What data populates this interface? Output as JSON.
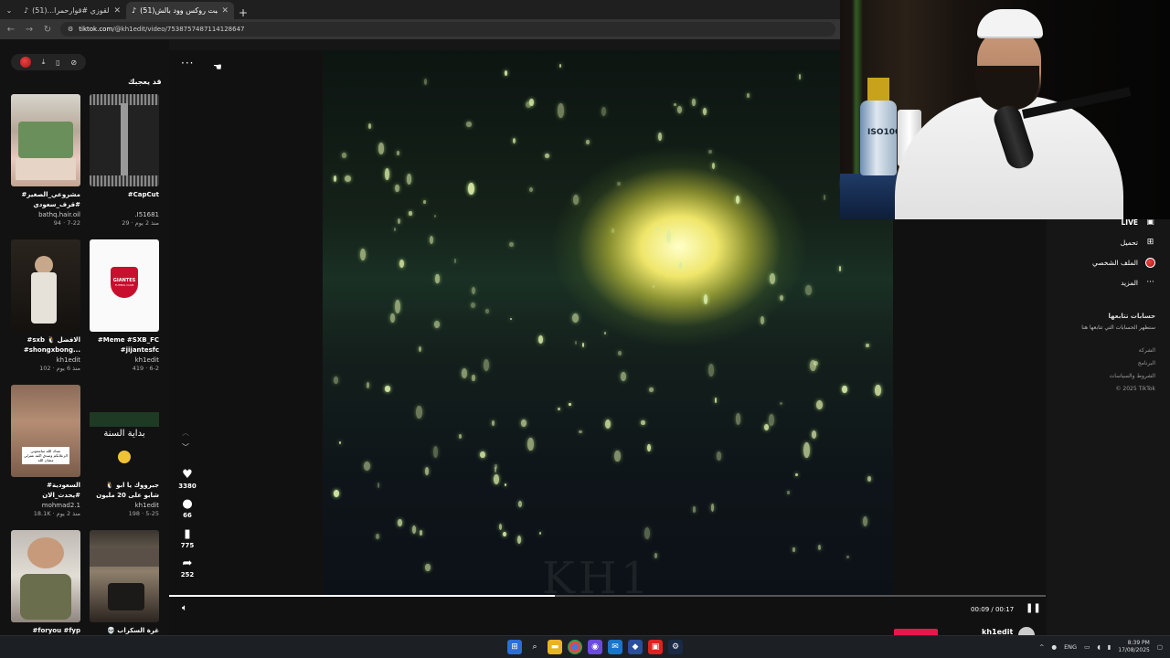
{
  "browser": {
    "tabs": [
      {
        "label": "ياعمري بالقوزي #قوارحمرا...(51)",
        "active": false
      },
      {
        "label": "(51)سحبت روكس وود بالش",
        "active": true
      }
    ],
    "url_host": "tiktok.com",
    "url_path": "/@kh1edit/video/7538757487114128647"
  },
  "left": {
    "section_title": "قد يعجبك",
    "cards": [
      {
        "title": "#مشروعي_الصغير #قرف_سعودي #تجي...",
        "author": "bathq.hair.oil",
        "meta": "94 · 7-22"
      },
      {
        "title": "#CapCut",
        "author": ".I51681",
        "meta": "29 · منذ 2 يوم"
      },
      {
        "title": "#sxb 🐧 الافضل #shongxbong...",
        "author": "kh1edit",
        "meta": "102 · منذ 6 يوم"
      },
      {
        "title": "#Meme #SXB_FC #jijantesfc",
        "author": "kh1edit",
        "meta": "419 · 6-2"
      },
      {
        "title": "#السعودية #يحدث_الان #الرياض_الان #هاشتاق...",
        "author": "mohmad2.1",
        "meta": "18.1K · منذ 2 يوم"
      },
      {
        "title": "🐧 جبرووك يا ابو شابو على 20 مليون #شوتيق #SXB...",
        "author": "kh1edit",
        "meta": "198 · 5-25"
      },
      {
        "title": "#foryou #fyp",
        "author": "",
        "meta": ""
      },
      {
        "title": "💀 غرة السكراب #شوتيق",
        "author": "",
        "meta": ""
      }
    ],
    "thumb_texts": {
      "giantes_logo": "GIANTES",
      "giantes_sub": "FUTBOL CLUB",
      "new_year": "بداية السنة",
      "meme_caption": "عندك الله سامحوني الزعلانكم وصدق اكفد غفرلي مشان الله"
    }
  },
  "video": {
    "more": "···",
    "watermark": "KH1",
    "time": "00:09 / 00:17",
    "progress": 0.44,
    "author": "kh1edit",
    "actions": [
      {
        "name": "like",
        "icon": "♥",
        "count": "3380"
      },
      {
        "name": "comment",
        "icon": "●",
        "count": "66"
      },
      {
        "name": "save",
        "icon": "▮",
        "count": "775"
      },
      {
        "name": "share",
        "icon": "➦",
        "count": "252"
      }
    ]
  },
  "right": {
    "nav": [
      {
        "label": "LIVE",
        "icon": "▣"
      },
      {
        "label": "تحميل",
        "icon": "⊞"
      },
      {
        "label": "الملف الشخصي",
        "icon": "avatar"
      },
      {
        "label": "المزيد",
        "icon": "···"
      }
    ],
    "following_title": "حسابات تتابعها",
    "following_sub": "ستظهر الحسابات التي تتابعها هنا",
    "footer": [
      "الشركة",
      "البرنامج",
      "الشروط والسياسات",
      "© 2025 TikTok"
    ]
  },
  "webcam": {
    "bottle_label": "ISO100"
  },
  "taskbar": {
    "lang": "ENG",
    "time": "8:39 PM",
    "date": "17/08/2025"
  },
  "colors": {
    "accent": "#e8174a",
    "page_bg": "#161616",
    "glow": "#f7f08a"
  }
}
